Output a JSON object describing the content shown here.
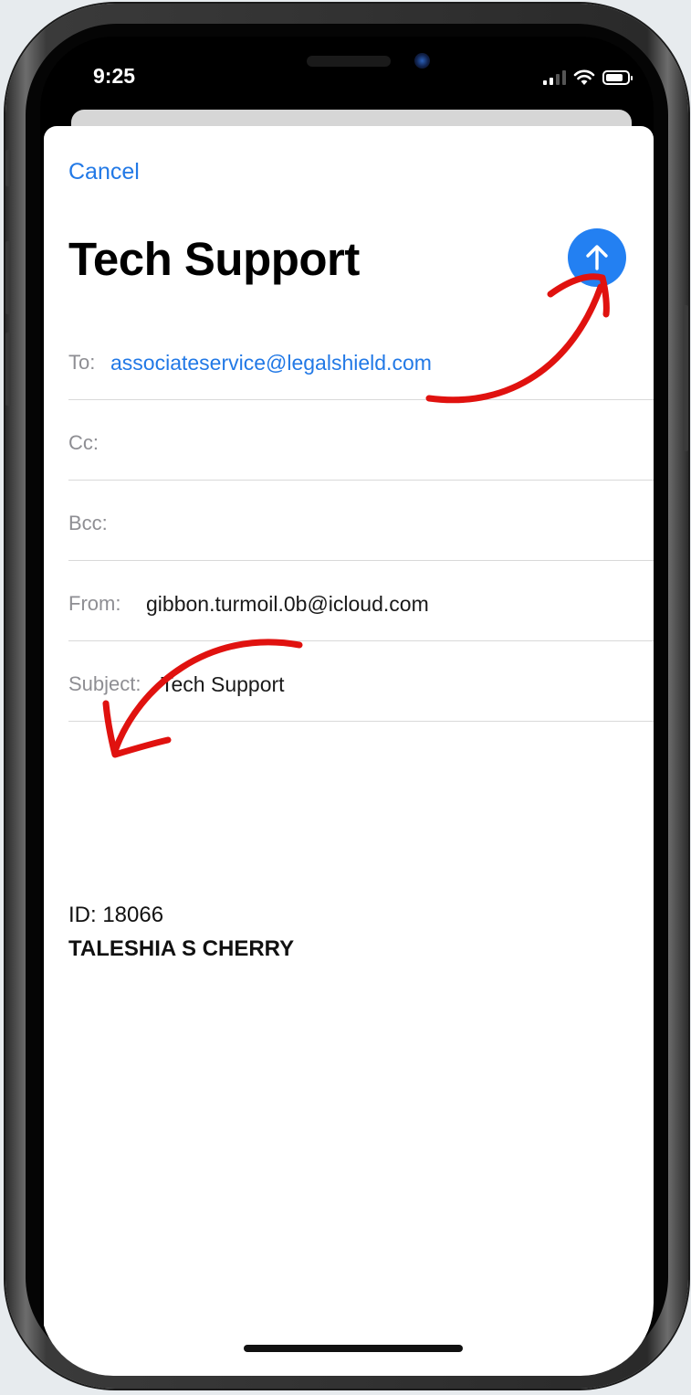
{
  "status_bar": {
    "time": "9:25"
  },
  "compose": {
    "cancel_label": "Cancel",
    "title": "Tech Support",
    "fields": {
      "to_label": "To:",
      "to_value": "associateservice@legalshield.com",
      "cc_label": "Cc:",
      "bcc_label": "Bcc:",
      "from_label": "From:",
      "from_value": "gibbon.turmoil.0b@icloud.com",
      "subject_label": "Subject:",
      "subject_value": "Tech Support"
    },
    "body": {
      "id_line": "ID: 18066",
      "name_line": "TALESHIA S CHERRY"
    }
  },
  "icons": {
    "send": "arrow-up-icon",
    "signal": "cellular-signal-icon",
    "wifi": "wifi-icon",
    "battery": "battery-icon"
  },
  "colors": {
    "accent": "#2279e6",
    "send_button": "#2380f2",
    "annotation": "#e0120f",
    "label_gray": "#8e8e93"
  }
}
